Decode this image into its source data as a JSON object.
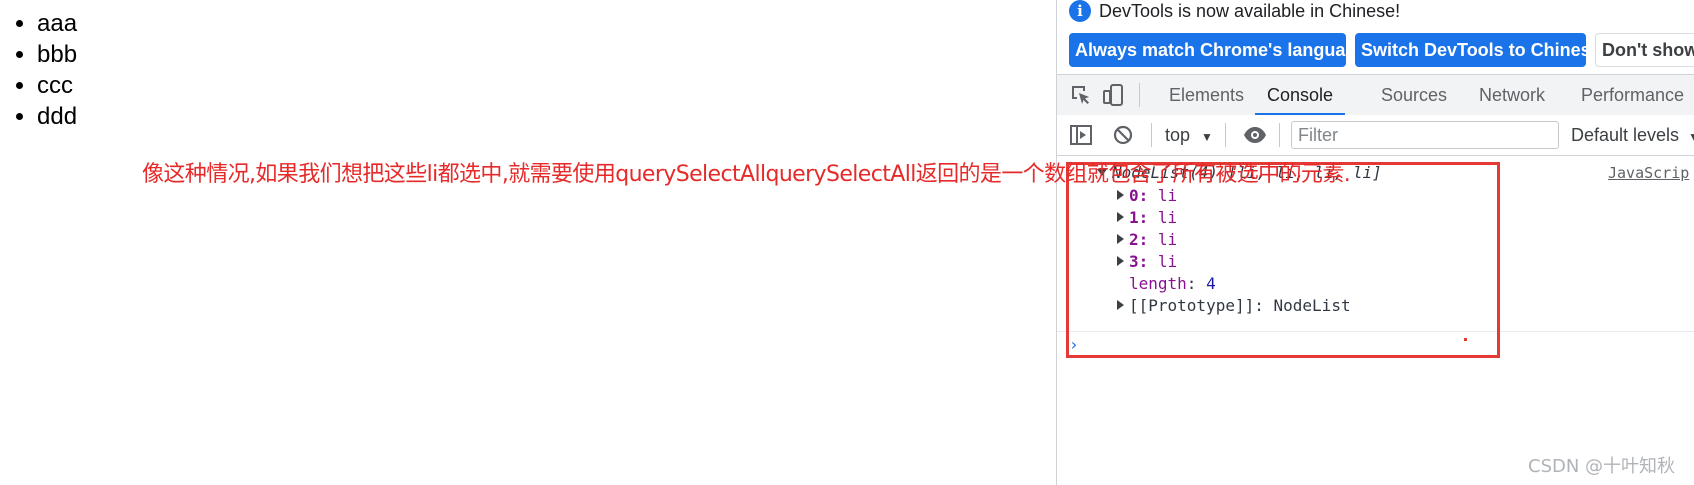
{
  "page": {
    "list_items": [
      "aaa",
      "bbb",
      "ccc",
      "ddd"
    ],
    "annotation": "像这种情况,如果我们想把这些li都选中,就需要使用querySelectAllquerySelectAll返回的是一个数组就包含了所有被选中的元素."
  },
  "devtools": {
    "infobar": {
      "icon": "info-icon",
      "message": "DevTools is now available in Chinese!",
      "btn_match": "Always match Chrome's language",
      "btn_switch": "Switch DevTools to Chinese",
      "btn_dont": "Don't show"
    },
    "tabs": [
      "Elements",
      "Console",
      "Sources",
      "Network",
      "Performance"
    ],
    "active_tab": "Console",
    "toolbar": {
      "context": "top",
      "filter_placeholder": "Filter",
      "levels": "Default levels"
    },
    "console": {
      "header_prefix": "NodeList(4)",
      "header_mid": "[li, li, li, li]",
      "source_link": "JavaScrip",
      "entries": [
        {
          "key": "0",
          "value": "li"
        },
        {
          "key": "1",
          "value": "li"
        },
        {
          "key": "2",
          "value": "li"
        },
        {
          "key": "3",
          "value": "li"
        }
      ],
      "length_key": "length",
      "length_value": "4",
      "proto_key": "[[Prototype]]",
      "proto_value": "NodeList",
      "prompt": "›"
    }
  },
  "watermark": "CSDN @十叶知秋",
  "colors": {
    "accent": "#1a73e8",
    "annotation": "#e62a2a",
    "box": "#e53935"
  }
}
